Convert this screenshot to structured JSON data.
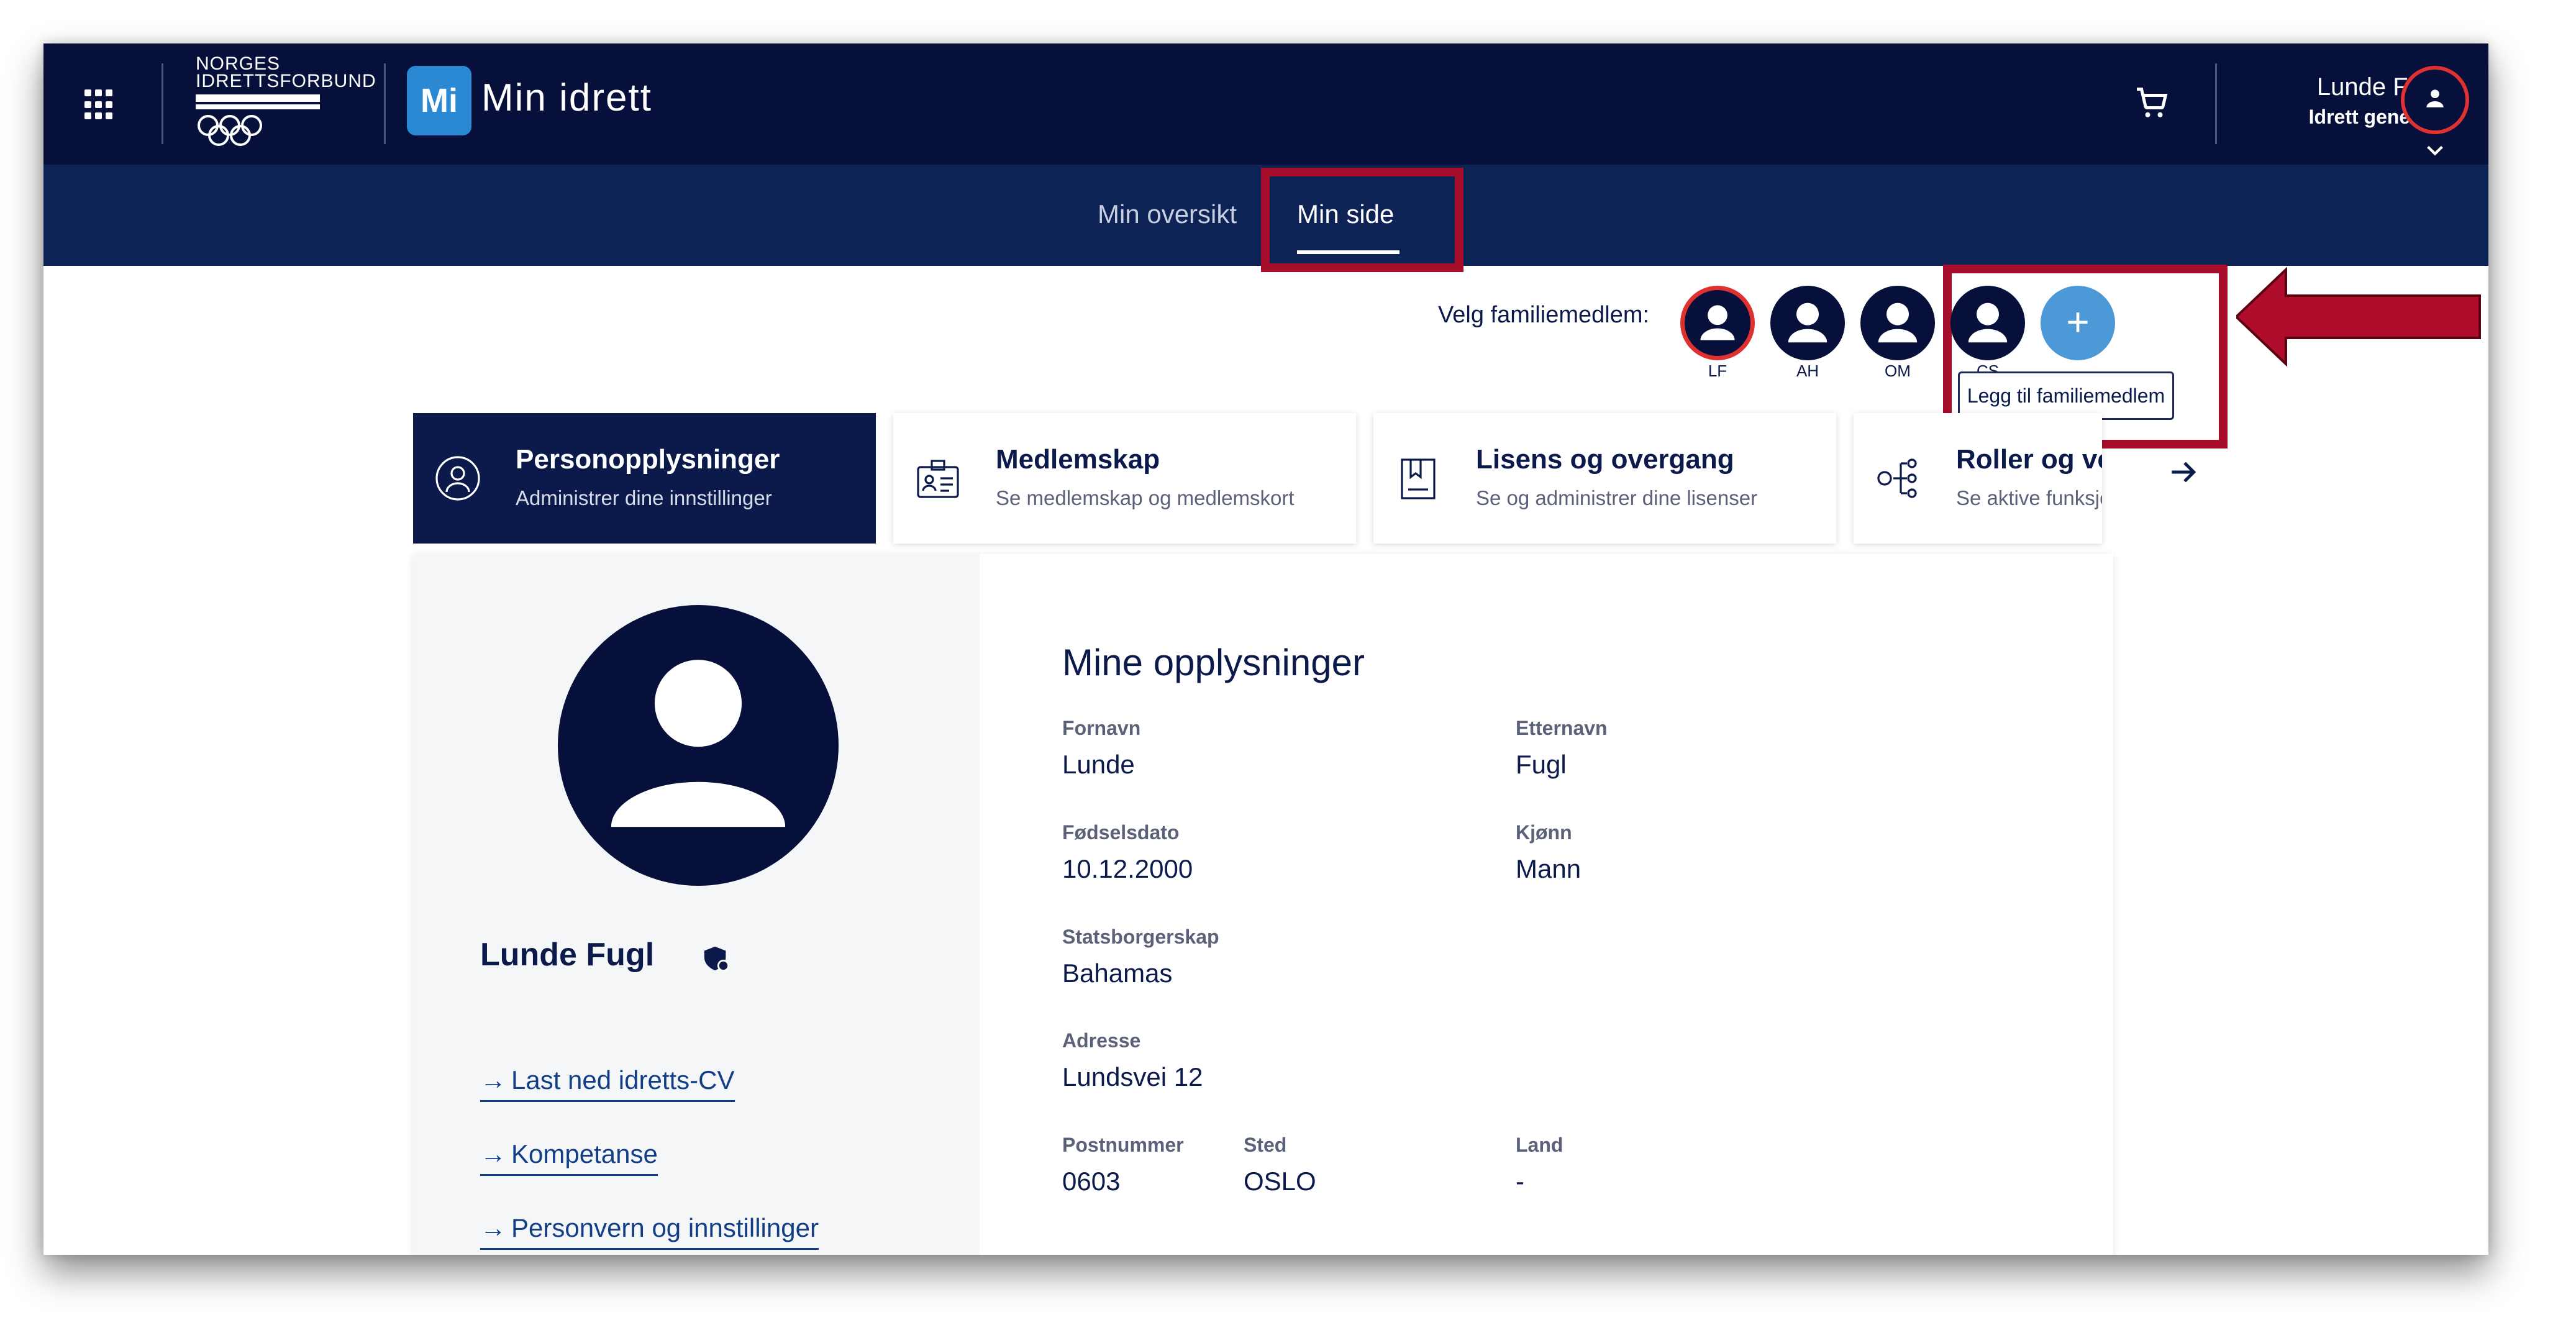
{
  "header": {
    "org_line1": "NORGES",
    "org_line2": "IDRETTSFORBUND",
    "app_badge": "Mi",
    "app_title": "Min idrett",
    "user_name": "Lunde Fugl",
    "user_role": "Idrett generelt"
  },
  "nav": {
    "tabs": [
      {
        "label": "Min oversikt",
        "active": false
      },
      {
        "label": "Min side",
        "active": true
      }
    ]
  },
  "family": {
    "label": "Velg familiemedlem:",
    "members": [
      {
        "initials": "LF",
        "selected": true
      },
      {
        "initials": "AH",
        "selected": false
      },
      {
        "initials": "OM",
        "selected": false
      },
      {
        "initials": "CS",
        "selected": false
      }
    ],
    "add_symbol": "+",
    "add_tooltip": "Legg til familiemedlem"
  },
  "cards": [
    {
      "title": "Personopplysninger",
      "subtitle": "Administrer dine innstillinger",
      "icon": "person-circle-icon",
      "active": true
    },
    {
      "title": "Medlemskap",
      "subtitle": "Se medlemskap og medlemskort",
      "icon": "id-card-icon",
      "active": false
    },
    {
      "title": "Lisens og overgang",
      "subtitle": "Se og administrer dine lisenser",
      "icon": "license-icon",
      "active": false
    },
    {
      "title": "Roller og ver",
      "subtitle": "Se aktive funksjo",
      "icon": "roles-tree-icon",
      "active": false
    }
  ],
  "profile": {
    "name": "Lunde Fugl",
    "links": [
      {
        "label": "Last ned idretts-CV",
        "arrow": "→"
      },
      {
        "label": "Kompetanse",
        "arrow": "→"
      },
      {
        "label": "Personvern og innstillinger",
        "arrow": "→"
      }
    ]
  },
  "info": {
    "title": "Mine opplysninger",
    "fields": {
      "fornavn": {
        "label": "Fornavn",
        "value": "Lunde"
      },
      "etternavn": {
        "label": "Etternavn",
        "value": "Fugl"
      },
      "fodselsdato": {
        "label": "Fødselsdato",
        "value": "10.12.2000"
      },
      "kjonn": {
        "label": "Kjønn",
        "value": "Mann"
      },
      "statsborgerskap": {
        "label": "Statsborgerskap",
        "value": "Bahamas"
      },
      "adresse": {
        "label": "Adresse",
        "value": "Lundsvei 12"
      },
      "postnummer": {
        "label": "Postnummer",
        "value": "0603"
      },
      "sted": {
        "label": "Sted",
        "value": "OSLO"
      },
      "land": {
        "label": "Land",
        "value": "-"
      }
    }
  },
  "colors": {
    "header_bg": "#06103b",
    "subnav_bg": "#0d2356",
    "highlight": "#a50d2b",
    "accent_blue": "#4d98d6",
    "selected_ring": "#e03131"
  }
}
